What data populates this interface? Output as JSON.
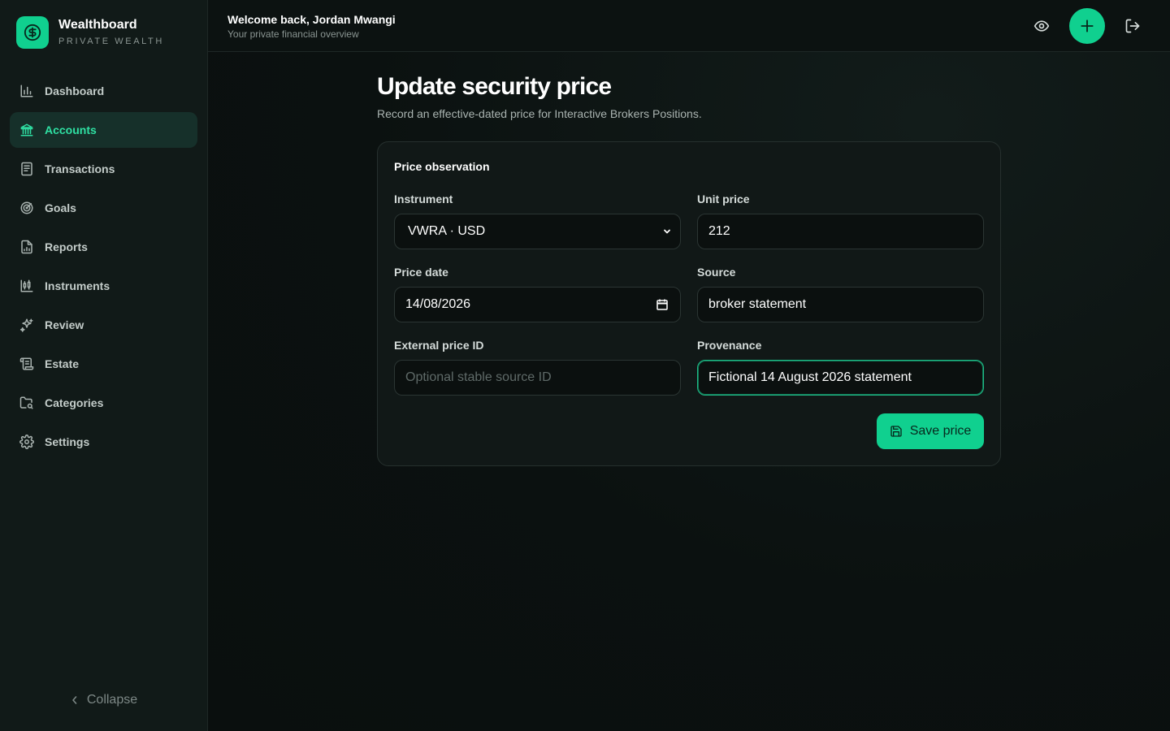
{
  "brand": {
    "name": "Wealthboard",
    "subtitle": "PRIVATE WEALTH"
  },
  "sidebar": {
    "items": [
      {
        "label": "Dashboard",
        "icon": "bar-chart-icon",
        "active": false
      },
      {
        "label": "Accounts",
        "icon": "bank-icon",
        "active": true
      },
      {
        "label": "Transactions",
        "icon": "receipt-icon",
        "active": false
      },
      {
        "label": "Goals",
        "icon": "target-icon",
        "active": false
      },
      {
        "label": "Reports",
        "icon": "file-chart-icon",
        "active": false
      },
      {
        "label": "Instruments",
        "icon": "candlestick-chart-icon",
        "active": false
      },
      {
        "label": "Review",
        "icon": "sparkles-icon",
        "active": false
      },
      {
        "label": "Estate",
        "icon": "scroll-icon",
        "active": false
      },
      {
        "label": "Categories",
        "icon": "folder-search-icon",
        "active": false
      },
      {
        "label": "Settings",
        "icon": "gear-icon",
        "active": false
      }
    ],
    "collapse_label": "Collapse"
  },
  "header": {
    "welcome": "Welcome back, Jordan Mwangi",
    "subtitle": "Your private financial overview",
    "actions": [
      "eye-icon",
      "plus-icon",
      "logout-icon"
    ]
  },
  "page": {
    "title": "Update security price",
    "subtitle": "Record an effective-dated price for Interactive Brokers Positions."
  },
  "form": {
    "section_title": "Price observation",
    "instrument": {
      "label": "Instrument",
      "value": "VWRA · USD"
    },
    "unit_price": {
      "label": "Unit price",
      "value": "212"
    },
    "price_date": {
      "label": "Price date",
      "value": "14/08/2026"
    },
    "source": {
      "label": "Source",
      "value": "broker statement"
    },
    "external_id": {
      "label": "External price ID",
      "value": "",
      "placeholder": "Optional stable source ID"
    },
    "provenance": {
      "label": "Provenance",
      "value": "Fictional 14 August 2026 statement"
    },
    "save_label": "Save price"
  },
  "colors": {
    "accent": "#10d08f",
    "background": "#0b1110",
    "sidebar": "#111a18",
    "active_nav": "#16302a"
  }
}
